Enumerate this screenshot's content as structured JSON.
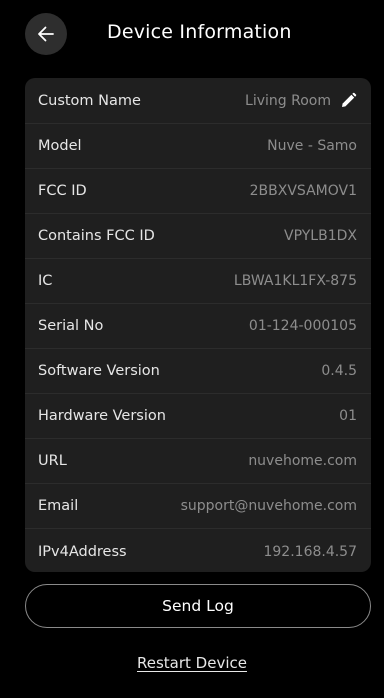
{
  "header": {
    "back_icon": "arrow-left-icon",
    "title": "Device Information"
  },
  "device_info": {
    "rows": [
      {
        "label": "Custom Name",
        "value": "Living Room",
        "editable": true,
        "edit_icon": "pencil-icon"
      },
      {
        "label": "Model",
        "value": "Nuve - Samo"
      },
      {
        "label": "FCC ID",
        "value": "2BBXVSAMOV1"
      },
      {
        "label": "Contains FCC ID",
        "value": "VPYLB1DX"
      },
      {
        "label": "IC",
        "value": "LBWA1KL1FX-875"
      },
      {
        "label": "Serial No",
        "value": "01-124-000105"
      },
      {
        "label": "Software Version",
        "value": "0.4.5"
      },
      {
        "label": "Hardware Version",
        "value": "01"
      },
      {
        "label": "URL",
        "value": "nuvehome.com"
      },
      {
        "label": "Email",
        "value": "support@nuvehome.com"
      },
      {
        "label": "IPv4Address",
        "value": "192.168.4.57"
      }
    ]
  },
  "actions": {
    "send_log_label": "Send Log",
    "restart_label": "Restart Device"
  },
  "colors": {
    "background": "#000000",
    "card": "#1f1f1f",
    "label": "#e6e6e6",
    "value": "#8d8d8d",
    "button_border": "#8a8a8a"
  }
}
